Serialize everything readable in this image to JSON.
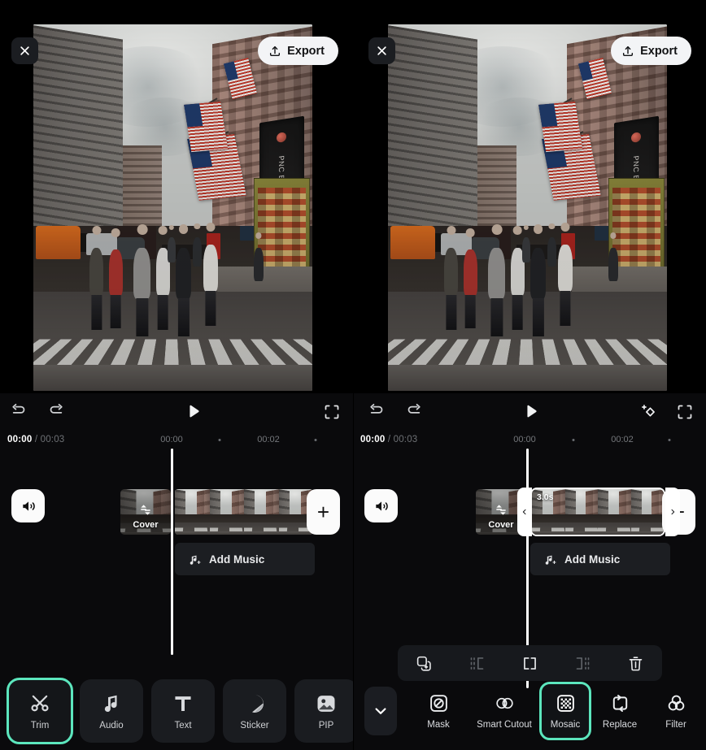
{
  "accent_color": "#5ce6bd",
  "panels": [
    {
      "id": "left",
      "header": {
        "close_label": "×",
        "close_icon": "close-icon",
        "export_label": "Export",
        "export_icon": "upload-icon"
      },
      "preview": {
        "scene_description": "City street with buildings, American flags, PNC BANK sign and pedestrians on crosswalk",
        "sign_text": "PNC BANK"
      },
      "player": {
        "undo_icon": "undo-icon",
        "redo_icon": "redo-icon",
        "play_icon": "play-icon",
        "fullscreen_icon": "fullscreen-icon",
        "keyframe_icon": null
      },
      "timeline": {
        "current_time": "00:00",
        "separator": " / ",
        "total_time": "00:03",
        "ticks": [
          "00:00",
          "00:02"
        ],
        "volume_icon": "volume-icon",
        "cover_label": "Cover",
        "cover_icon": "swap-icon",
        "add_label": "+",
        "add_icon": "plus-icon",
        "music_label": "Add Music",
        "music_icon": "music-note-plus-icon",
        "clip_selected": false,
        "clip_duration": null
      },
      "toolbar": {
        "items": [
          {
            "label": "Trim",
            "icon": "scissors-icon",
            "active": true
          },
          {
            "label": "Audio",
            "icon": "music-note-icon",
            "active": false
          },
          {
            "label": "Text",
            "icon": "text-t-icon",
            "active": false
          },
          {
            "label": "Sticker",
            "icon": "sticker-icon",
            "active": false
          },
          {
            "label": "PIP",
            "icon": "picture-in-picture-icon",
            "active": false
          }
        ]
      },
      "action_bar": null
    },
    {
      "id": "right",
      "header": {
        "close_label": "×",
        "close_icon": "close-icon",
        "export_label": "Export",
        "export_icon": "upload-icon"
      },
      "preview": {
        "scene_description": "City street with buildings, American flags, PNC BANK sign and pedestrians on crosswalk",
        "sign_text": "PNC BANK"
      },
      "player": {
        "undo_icon": "undo-icon",
        "redo_icon": "redo-icon",
        "play_icon": "play-icon",
        "fullscreen_icon": "fullscreen-icon",
        "keyframe_icon": "add-keyframe-icon"
      },
      "timeline": {
        "current_time": "00:00",
        "separator": " / ",
        "total_time": "00:03",
        "ticks": [
          "00:00",
          "00:02"
        ],
        "volume_icon": "volume-icon",
        "cover_label": "Cover",
        "cover_icon": "swap-icon",
        "add_label": "+",
        "add_icon": "plus-icon",
        "music_label": "Add Music",
        "music_icon": "music-note-plus-icon",
        "clip_selected": true,
        "clip_duration": "3.0s"
      },
      "toolbar": {
        "collapse_icon": "chevron-down-icon",
        "items": [
          {
            "label": "Mask",
            "icon": "mask-icon",
            "active": false
          },
          {
            "label": "Smart Cutout",
            "icon": "smart-cutout-icon",
            "active": false
          },
          {
            "label": "Mosaic",
            "icon": "mosaic-icon",
            "active": true
          },
          {
            "label": "Replace",
            "icon": "replace-icon",
            "active": false
          },
          {
            "label": "Filter",
            "icon": "filter-icon",
            "active": false
          }
        ]
      },
      "action_bar": {
        "items": [
          {
            "name": "duplicate",
            "icon": "duplicate-icon",
            "dim": false
          },
          {
            "name": "trim-start",
            "icon": "trim-start-icon",
            "dim": true
          },
          {
            "name": "split",
            "icon": "split-icon",
            "dim": false
          },
          {
            "name": "trim-end",
            "icon": "trim-end-icon",
            "dim": true
          },
          {
            "name": "delete",
            "icon": "trash-icon",
            "dim": false
          }
        ]
      }
    }
  ]
}
